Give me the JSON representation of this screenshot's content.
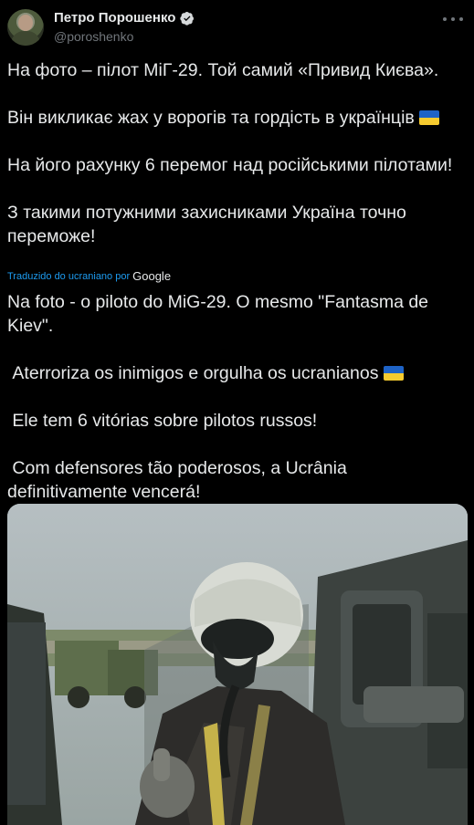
{
  "author": {
    "name": "Петро Порошенко",
    "handle": "@poroshenko"
  },
  "icons": {
    "verified": "verified-badge-icon",
    "more": "more-options-icon",
    "flag": "ukraine-flag-emoji"
  },
  "tweet": {
    "p1": "На фото – пілот МіГ-29. Той самий «Привид Києва».",
    "p2": "Він викликає жах у ворогів та гордість в українців",
    "p3": "На його рахунку 6 перемог над російськими пілотами!",
    "p4": "З такими потужними захисниками Україна точно переможе!"
  },
  "translation": {
    "label": "Traduzido do ucraniano por",
    "provider": "Google",
    "p1": "Na foto - o piloto do MiG-29. O mesmo \"Fantasma de Kiev\".",
    "p2": " Aterroriza os inimigos e orgulha os ucranianos",
    "p3": " Ele tem 6 vitórias sobre pilotos russos!",
    "p4": " Com defensores tão poderosos, a Ucrânia definitivamente vencerá!"
  },
  "colors": {
    "background": "#000000",
    "text": "#e7e9ea",
    "secondary": "#71767b",
    "link": "#1d9bf0",
    "flag_blue": "#1e63c6",
    "flag_yellow": "#f6cb2f"
  }
}
